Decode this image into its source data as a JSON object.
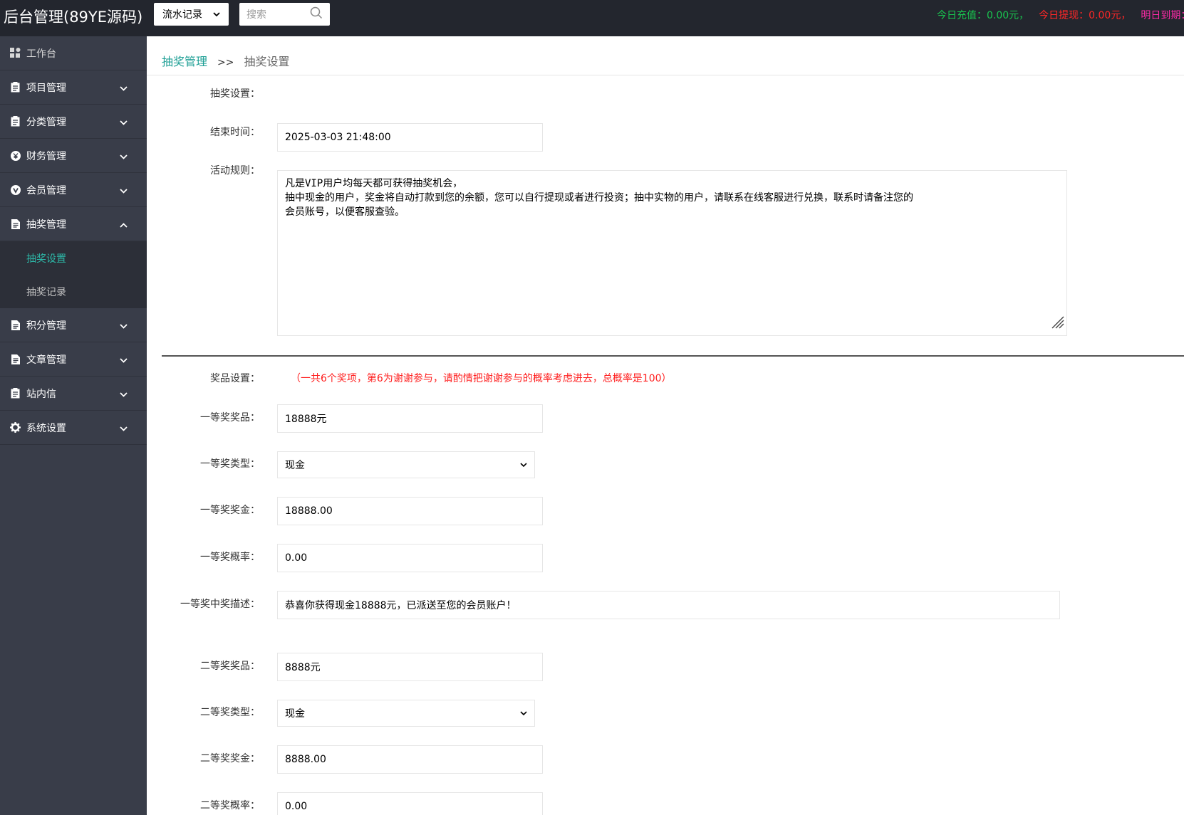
{
  "header": {
    "brand": "后台管理(89YE源码)",
    "filter_select": "流水记录",
    "search_placeholder": "搜索",
    "stat_recharge": "今日充值：0.00元，",
    "stat_withdraw": "今日提现：0.00元，",
    "stat_due": "明日到期："
  },
  "sidebar": {
    "dashboard": "工作台",
    "items": [
      "项目管理",
      "分类管理",
      "财务管理",
      "会员管理",
      "抽奖管理",
      "积分管理",
      "文章管理",
      "站内信",
      "系统设置"
    ],
    "lottery_sub": [
      "抽奖设置",
      "抽奖记录"
    ]
  },
  "breadcrumb": {
    "parent": "抽奖管理",
    "separator": ">>",
    "current": "抽奖设置"
  },
  "form": {
    "section_label": "抽奖设置：",
    "end_time_label": "结束时间：",
    "end_time_value": "2025-03-03 21:48:00",
    "rules_label": "活动规则：",
    "rules_lines": [
      "凡是VIP用户均每天都可获得抽奖机会，",
      "抽中现金的用户，奖金将自动打款到您的余额，您可以自行提现或者进行投资；抽中实物的用户，请联系在线客服进行兑换，联系时请备注您的",
      "会员账号，以便客服查验。"
    ],
    "prize_label": "奖品设置：",
    "prize_note": "（一共6个奖项，第6为谢谢参与，请酌情把谢谢参与的概率考虑进去，总概率是100）",
    "first": {
      "prize_label": "一等奖奖品：",
      "prize_value": "18888元",
      "type_label": "一等奖类型：",
      "type_value": "现金",
      "amount_label": "一等奖奖金：",
      "amount_value": "18888.00",
      "rate_label": "一等奖概率：",
      "rate_value": "0.00",
      "desc_label": "一等奖中奖描述：",
      "desc_value": "恭喜你获得现金18888元，已派送至您的会员账户！"
    },
    "second": {
      "prize_label": "二等奖奖品：",
      "prize_value": "8888元",
      "type_label": "二等奖类型：",
      "type_value": "现金",
      "amount_label": "二等奖奖金：",
      "amount_value": "8888.00",
      "rate_label": "二等奖概率：",
      "rate_value": "0.00"
    }
  },
  "colors": {
    "topbar": "#23262e",
    "sidebar": "#393d49",
    "accent": "#1e9f95",
    "note_red": "#ff1e1e"
  }
}
